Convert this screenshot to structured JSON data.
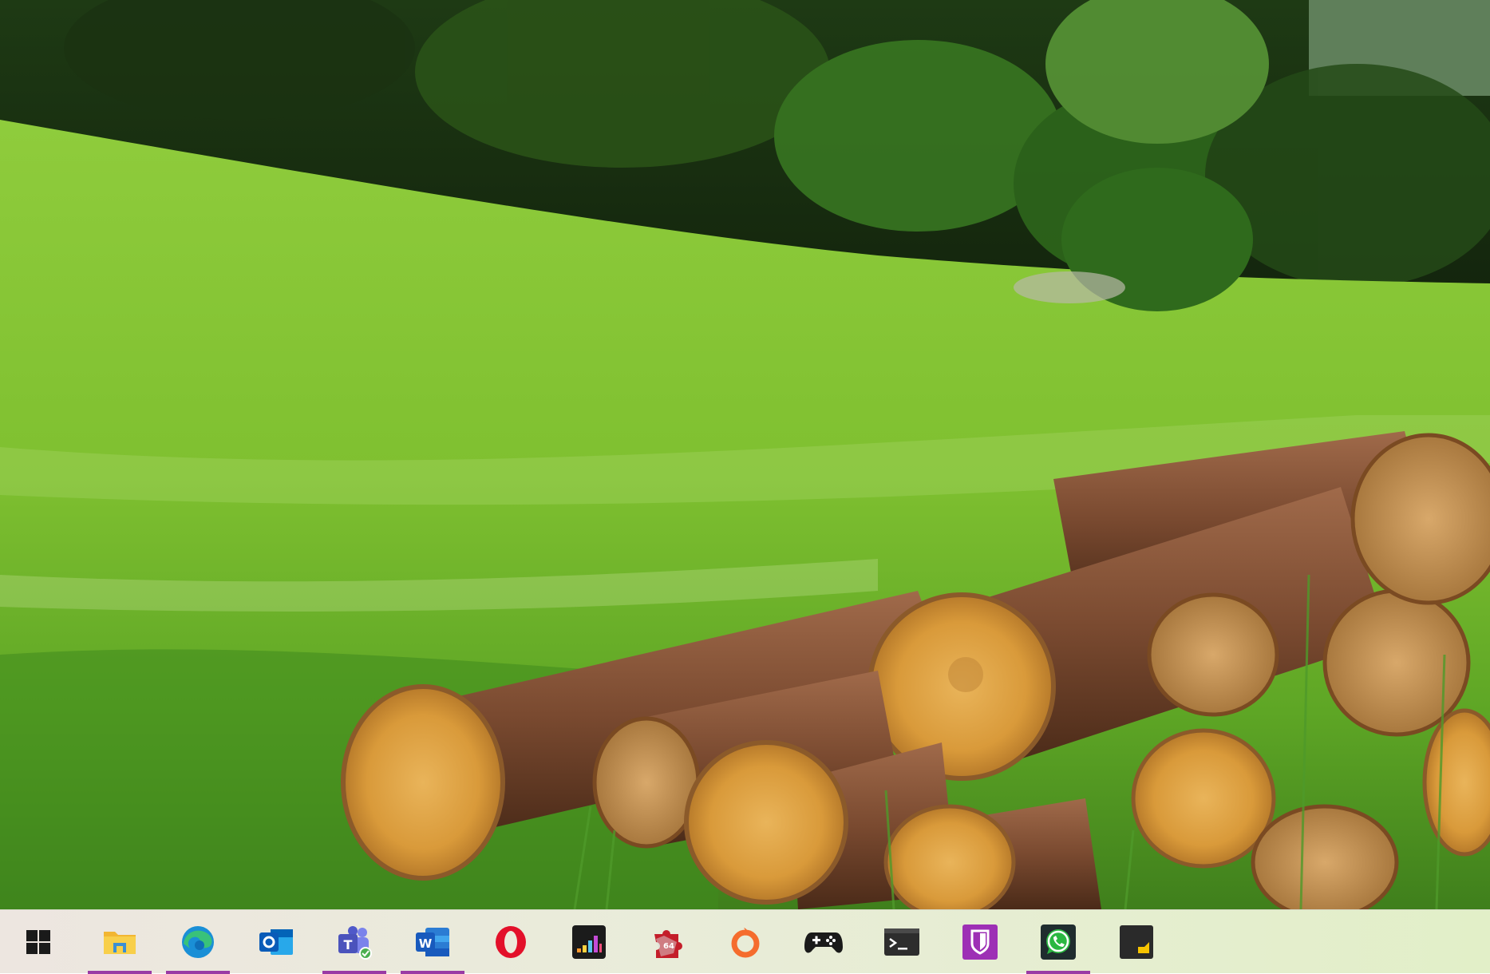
{
  "desktop": {
    "wallpaper": "meadow-with-stacked-logs"
  },
  "taskbar": {
    "accent_color": "#9a3aa5",
    "start": {
      "icon": "windows-logo-icon"
    },
    "apps": [
      {
        "id": "file-explorer",
        "icon": "folder-icon",
        "running": true
      },
      {
        "id": "edge",
        "icon": "edge-icon",
        "running": true
      },
      {
        "id": "outlook",
        "icon": "outlook-icon",
        "running": false
      },
      {
        "id": "teams",
        "icon": "teams-icon",
        "running": true
      },
      {
        "id": "word",
        "icon": "word-icon",
        "running": true
      },
      {
        "id": "opera",
        "icon": "opera-icon",
        "running": false
      },
      {
        "id": "deezer",
        "icon": "deezer-icon",
        "running": false
      },
      {
        "id": "puzzle-game",
        "icon": "puzzle-icon",
        "badge": "64",
        "running": false
      },
      {
        "id": "origin",
        "icon": "origin-icon",
        "running": false
      },
      {
        "id": "game-controller",
        "icon": "gamepad-icon",
        "running": false
      },
      {
        "id": "terminal",
        "icon": "terminal-icon",
        "running": false
      },
      {
        "id": "bitwarden",
        "icon": "bitwarden-icon",
        "running": false
      },
      {
        "id": "whatsapp",
        "icon": "whatsapp-icon",
        "running": true
      },
      {
        "id": "sticky-notes",
        "icon": "sticky-notes-icon",
        "running": false
      }
    ]
  }
}
